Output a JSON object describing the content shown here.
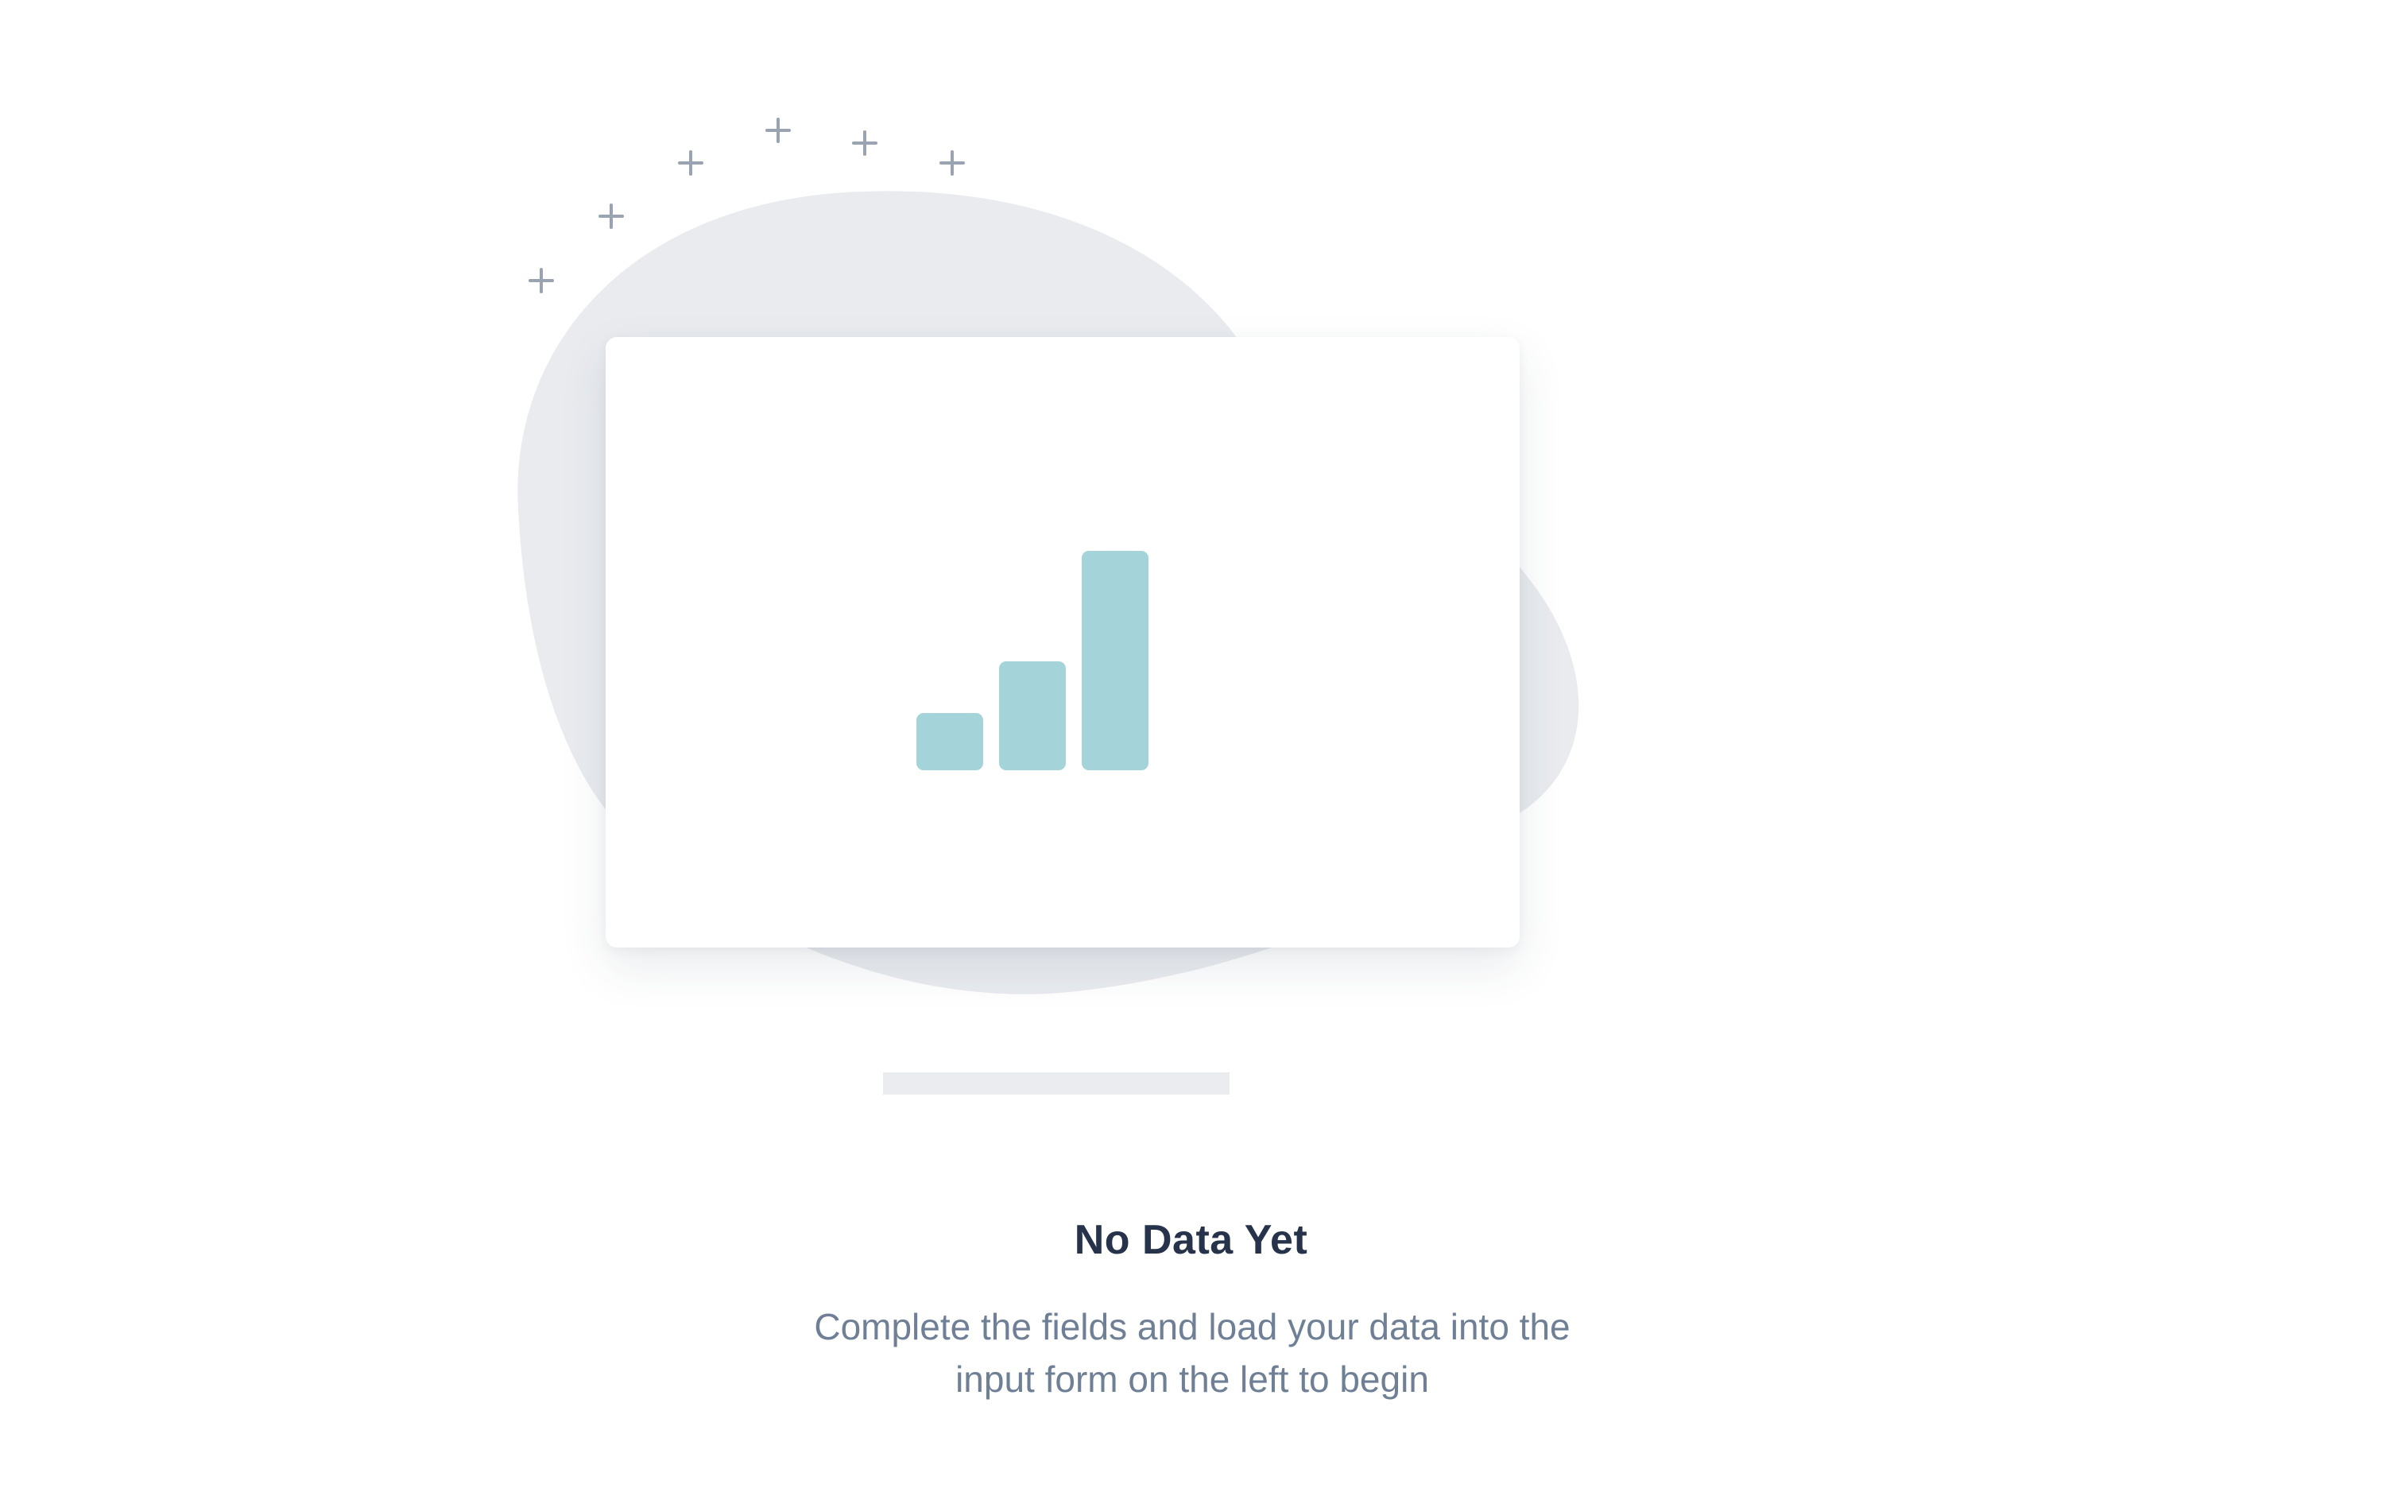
{
  "empty_state": {
    "title": "No Data Yet",
    "description": "Complete the fields and load your data into the input form on the left to begin"
  },
  "illustration": {
    "icon": "bar-chart-icon",
    "decorations": [
      "plus-icon",
      "plus-icon",
      "plus-icon",
      "plus-icon",
      "plus-icon",
      "plus-icon"
    ],
    "colors": {
      "bars": "#a4d4da",
      "blob": "#e9ebef",
      "sparkles": "#9aa3b1",
      "card": "#ffffff"
    }
  },
  "colors": {
    "title": "#27334a",
    "description": "#6f7f96",
    "background": "#ffffff"
  }
}
